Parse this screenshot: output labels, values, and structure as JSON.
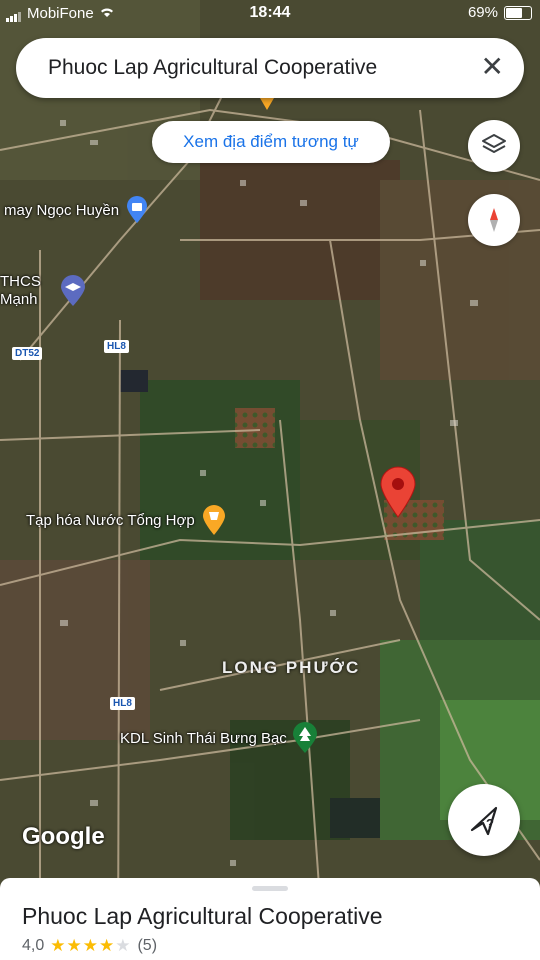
{
  "status_bar": {
    "carrier": "MobiFone",
    "time": "18:44",
    "battery": "69%",
    "battery_level": 0.69
  },
  "search": {
    "query": "Phuoc Lap Agricultural Cooperative",
    "clear_icon": "close-icon"
  },
  "similar_chip": {
    "label": "Xem địa điểm tương tự"
  },
  "controls": {
    "layers_icon": "layers-icon",
    "compass_icon": "compass-icon",
    "directions_icon": "directions-icon"
  },
  "map": {
    "pois": {
      "shop": "may Ngọc Huyền",
      "school_line1": "THCS",
      "school_line2": "Mạnh",
      "grocery": "Tạp hóa Nước Tổng Hợp",
      "park": "KDL Sinh Thái Bưng Bạc"
    },
    "roads": {
      "dt52": "DT52",
      "hl8_top": "HL8",
      "hl8_bottom": "HL8"
    },
    "area": "LONG PHƯỚC",
    "logo": "Google"
  },
  "place_sheet": {
    "title": "Phuoc Lap Agricultural Cooperative",
    "rating": "4,0",
    "rating_value": 4,
    "reviews": "(5)"
  },
  "colors": {
    "accent": "#1a73e8",
    "pin": "#ea4335",
    "star": "#fbbc04",
    "grocery_pin": "#f9a825",
    "park_pin": "#188038"
  }
}
